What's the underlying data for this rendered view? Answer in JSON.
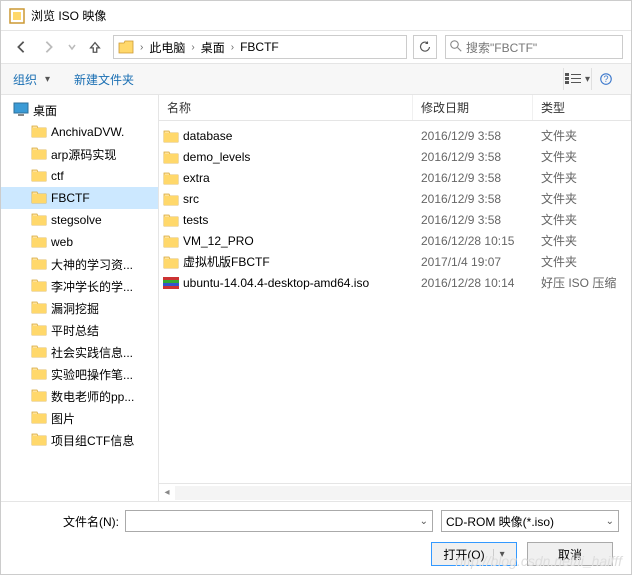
{
  "title": "浏览 ISO 映像",
  "breadcrumb": {
    "items": [
      "此电脑",
      "桌面",
      "FBCTF"
    ]
  },
  "search": {
    "placeholder": "搜索\"FBCTF\""
  },
  "toolbar": {
    "organize": "组织",
    "newfolder": "新建文件夹"
  },
  "tree": {
    "root": "桌面",
    "items": [
      {
        "label": "AnchivaDVW."
      },
      {
        "label": "arp源码实现"
      },
      {
        "label": "ctf"
      },
      {
        "label": "FBCTF",
        "selected": true
      },
      {
        "label": "stegsolve"
      },
      {
        "label": "web"
      },
      {
        "label": "大神的学习资..."
      },
      {
        "label": "李冲学长的学..."
      },
      {
        "label": "漏洞挖掘"
      },
      {
        "label": "平时总结"
      },
      {
        "label": "社会实践信息..."
      },
      {
        "label": "实验吧操作笔..."
      },
      {
        "label": "数电老师的pp..."
      },
      {
        "label": "图片"
      },
      {
        "label": "项目组CTF信息"
      }
    ]
  },
  "list": {
    "headers": {
      "name": "名称",
      "date": "修改日期",
      "type": "类型"
    },
    "rows": [
      {
        "icon": "folder",
        "name": "database",
        "date": "2016/12/9 3:58",
        "type": "文件夹"
      },
      {
        "icon": "folder",
        "name": "demo_levels",
        "date": "2016/12/9 3:58",
        "type": "文件夹"
      },
      {
        "icon": "folder",
        "name": "extra",
        "date": "2016/12/9 3:58",
        "type": "文件夹"
      },
      {
        "icon": "folder",
        "name": "src",
        "date": "2016/12/9 3:58",
        "type": "文件夹"
      },
      {
        "icon": "folder",
        "name": "tests",
        "date": "2016/12/9 3:58",
        "type": "文件夹"
      },
      {
        "icon": "folder",
        "name": "VM_12_PRO",
        "date": "2016/12/28 10:15",
        "type": "文件夹"
      },
      {
        "icon": "folder",
        "name": "虚拟机版FBCTF",
        "date": "2017/1/4 19:07",
        "type": "文件夹"
      },
      {
        "icon": "iso",
        "name": "ubuntu-14.04.4-desktop-amd64.iso",
        "date": "2016/12/28 10:14",
        "type": "好压 ISO 压缩"
      }
    ]
  },
  "bottom": {
    "filename_label": "文件名(N):",
    "filter": "CD-ROM 映像(*.iso)",
    "open": "打开(O)",
    "cancel": "取消"
  },
  "watermark": "http://blog.csdn.net/li_haifff"
}
